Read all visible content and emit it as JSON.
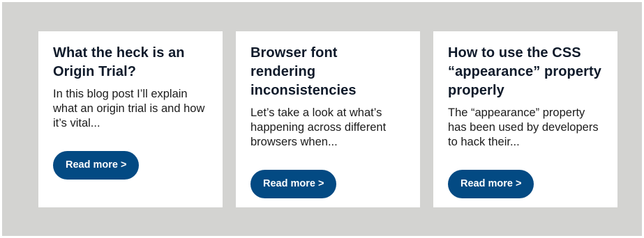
{
  "cards": [
    {
      "title": "What the heck is an Origin Trial?",
      "excerpt": "In this blog post I’ll explain what an origin trial is and how it’s vital...",
      "button_label": "Read more >"
    },
    {
      "title": "Browser font rendering inconsistencies",
      "excerpt": "Let’s take a look at what’s happening across different browsers when...",
      "button_label": "Read more >"
    },
    {
      "title": "How to use the CSS “appearance” property properly",
      "excerpt": "The “appearance” property has been used by developers to hack their...",
      "button_label": "Read more >"
    }
  ]
}
